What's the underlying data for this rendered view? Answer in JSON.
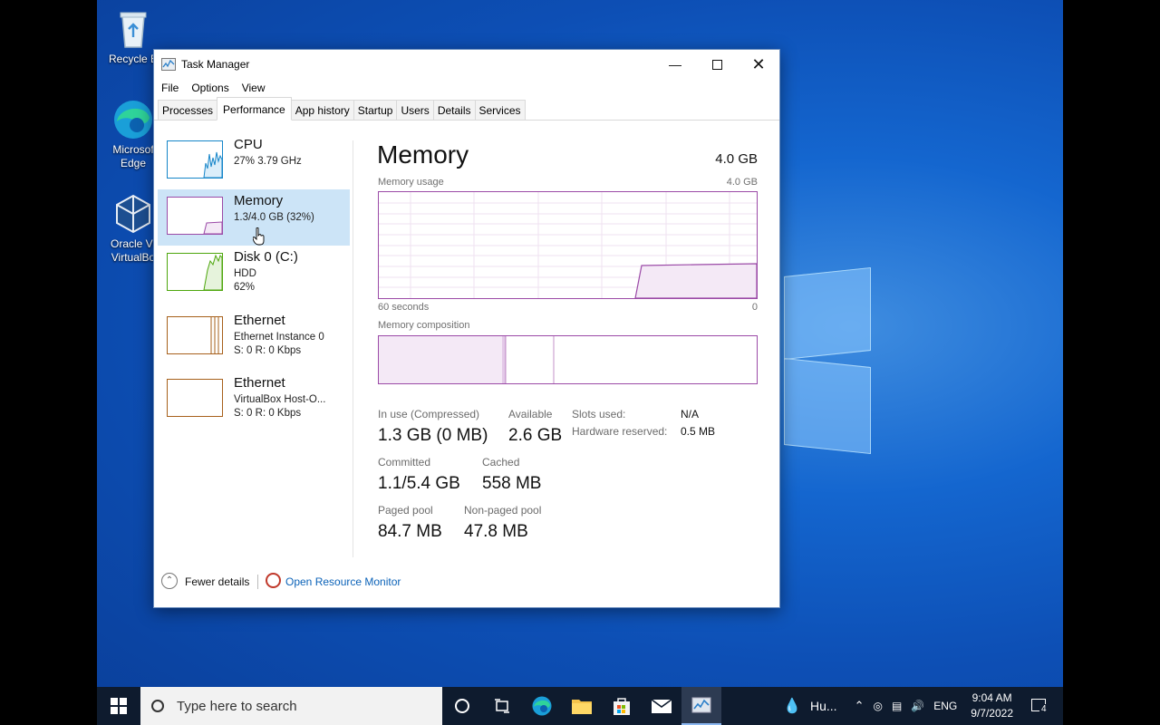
{
  "desktop": {
    "icons": [
      {
        "label": "Recycle B"
      },
      {
        "label": "Microsof Edge"
      },
      {
        "label": "Oracle VI VirtualBo"
      }
    ]
  },
  "window": {
    "title": "Task Manager",
    "menu": [
      "File",
      "Options",
      "View"
    ],
    "tabs": [
      "Processes",
      "Performance",
      "App history",
      "Startup",
      "Users",
      "Details",
      "Services"
    ],
    "active_tab": "Performance"
  },
  "sidebar": {
    "items": [
      {
        "name": "CPU",
        "sub1": "27%  3.79 GHz",
        "sub2": "",
        "color": "#1585c9"
      },
      {
        "name": "Memory",
        "sub1": "1.3/4.0 GB (32%)",
        "sub2": "",
        "color": "#9b4aa7",
        "selected": true
      },
      {
        "name": "Disk 0 (C:)",
        "sub1": "HDD",
        "sub2": "62%",
        "color": "#4da60c"
      },
      {
        "name": "Ethernet",
        "sub1": "Ethernet Instance 0",
        "sub2": "S: 0 R: 0 Kbps",
        "color": "#a7601b"
      },
      {
        "name": "Ethernet",
        "sub1": "VirtualBox Host-O...",
        "sub2": "S: 0 R: 0 Kbps",
        "color": "#a7601b"
      }
    ]
  },
  "memory": {
    "title": "Memory",
    "total": "4.0 GB",
    "usage_label": "Memory usage",
    "usage_max": "4.0 GB",
    "time_left": "60 seconds",
    "time_right": "0",
    "composition_label": "Memory composition",
    "stats": {
      "in_use_label": "In use (Compressed)",
      "in_use_value": "1.3 GB (0 MB)",
      "available_label": "Available",
      "available_value": "2.6 GB",
      "committed_label": "Committed",
      "committed_value": "1.1/5.4 GB",
      "cached_label": "Cached",
      "cached_value": "558 MB",
      "paged_label": "Paged pool",
      "paged_value": "84.7 MB",
      "nonpaged_label": "Non-paged pool",
      "nonpaged_value": "47.8 MB",
      "slots_label": "Slots used:",
      "slots_value": "N/A",
      "hwres_label": "Hardware reserved:",
      "hwres_value": "0.5 MB"
    }
  },
  "footer": {
    "fewer_details": "Fewer details",
    "open_resource_monitor": "Open Resource Monitor"
  },
  "taskbar": {
    "search_placeholder": "Type here to search",
    "weather": "Hu...",
    "language": "ENG",
    "time": "9:04 AM",
    "date": "9/7/2022",
    "notification_count": "4"
  }
}
